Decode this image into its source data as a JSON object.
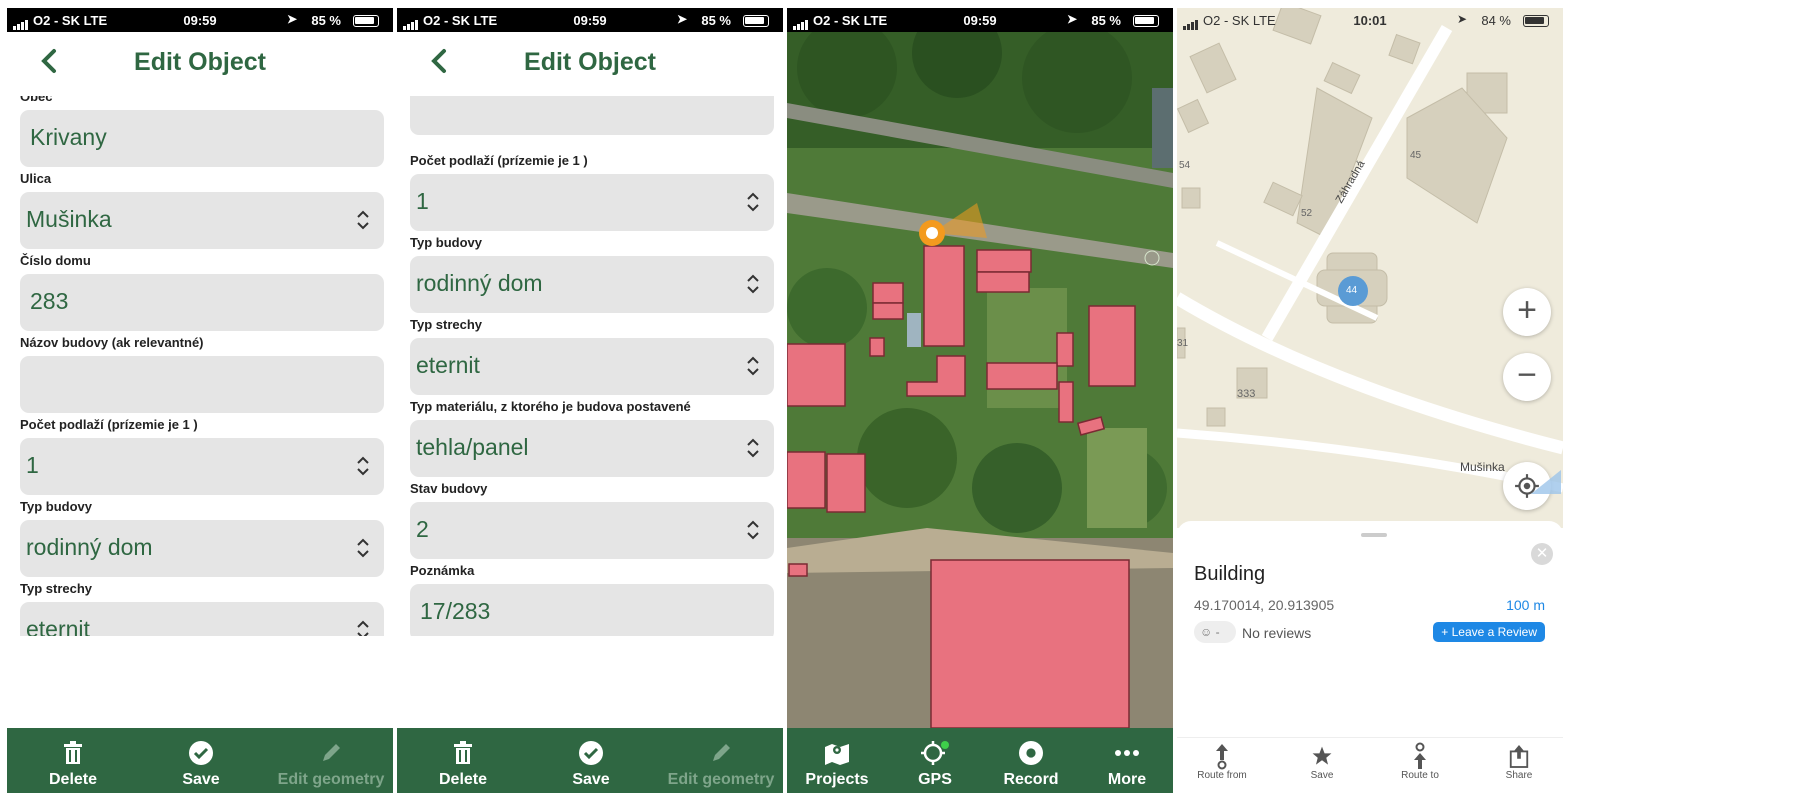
{
  "screens": [
    {
      "status": {
        "carrier": "O2 - SK  LTE",
        "time": "09:59",
        "battery": "85 %"
      },
      "header": {
        "title": "Edit Object"
      },
      "fields": [
        {
          "label": "Obec",
          "value": "Krivany"
        },
        {
          "label": "Ulica",
          "value": "Mušinka"
        },
        {
          "label": "Číslo domu",
          "value": "283"
        },
        {
          "label": "Názov budovy (ak relevantné)",
          "value": ""
        },
        {
          "label": "Počet podlaží (prízemie je 1 )",
          "value": "1"
        },
        {
          "label": "Typ budovy",
          "value": "rodinný dom"
        },
        {
          "label": "Typ strechy",
          "value": "eternit"
        }
      ],
      "toolbar": {
        "delete": "Delete",
        "save": "Save",
        "edit_geometry": "Edit geometry"
      }
    },
    {
      "status": {
        "carrier": "O2 - SK  LTE",
        "time": "09:59",
        "battery": "85 %"
      },
      "header": {
        "title": "Edit Object"
      },
      "fields": [
        {
          "label": "Počet podlaží (prízemie je 1 )",
          "value": "1"
        },
        {
          "label": "Typ budovy",
          "value": "rodinný dom"
        },
        {
          "label": "Typ strechy",
          "value": "eternit"
        },
        {
          "label": "Typ materiálu, z ktorého je budova postavené",
          "value": "tehla/panel"
        },
        {
          "label": "Stav budovy",
          "value": "2"
        },
        {
          "label": "Poznámka",
          "value": "17/283"
        }
      ],
      "toolbar": {
        "delete": "Delete",
        "save": "Save",
        "edit_geometry": "Edit geometry"
      }
    },
    {
      "status": {
        "carrier": "O2 - SK  LTE",
        "time": "09:59",
        "battery": "85 %"
      },
      "nav": {
        "projects": "Projects",
        "gps": "GPS",
        "record": "Record",
        "more": "More"
      }
    },
    {
      "status": {
        "carrier": "O2 - SK  LTE",
        "time": "10:01",
        "battery": "84 %"
      },
      "map_labels": {
        "street_1": "Záhradná",
        "street_2": "Mušinka",
        "n54": "54",
        "n52": "52",
        "n45": "45",
        "n44": "44",
        "n333": "333",
        "n31": "31"
      },
      "place": {
        "name": "Building",
        "coords": "49.170014, 20.913905",
        "distance": "100 m",
        "rating": "-",
        "reviews": "No reviews",
        "leave_review": "+ Leave a Review"
      },
      "actions": {
        "route_from": "Route from",
        "save": "Save",
        "route_to": "Route to",
        "share": "Share"
      }
    }
  ],
  "colors": {
    "brand_green": "#2f6742",
    "building_fill": "#e8727f",
    "gps_orange": "#f39a1e",
    "link_blue": "#1e88e5"
  },
  "icons": [
    "back-icon",
    "chevron-updown-icon",
    "trash-icon",
    "check-circle-icon",
    "pencil-icon",
    "map-icon",
    "crosshair-icon",
    "record-icon",
    "dots-icon",
    "plus-icon",
    "minus-icon",
    "locate-icon",
    "close-icon",
    "smiley-icon",
    "share-icon"
  ]
}
